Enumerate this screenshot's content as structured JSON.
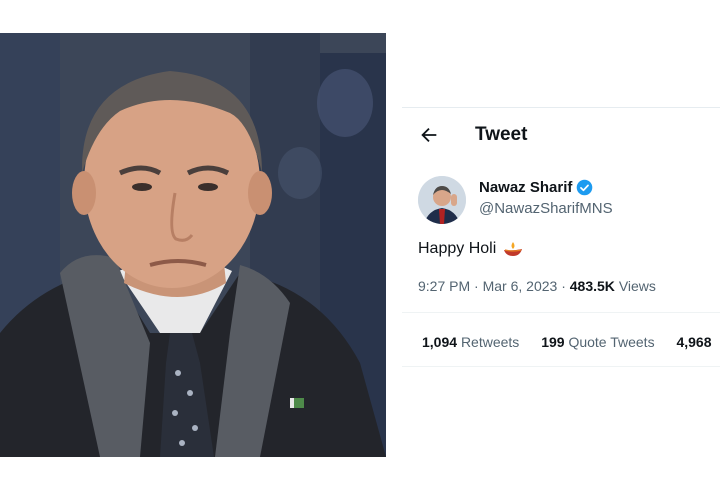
{
  "tweet_header": {
    "title": "Tweet"
  },
  "author": {
    "name": "Nawaz Sharif",
    "handle": "@NawazSharifMNS",
    "verified": true
  },
  "tweet": {
    "text": "Happy Holi",
    "emoji": "diya-lamp-icon",
    "time": "9:27 PM",
    "separator": "·",
    "date": "Mar 6, 2023",
    "views_count": "483.5K",
    "views_label": "Views"
  },
  "stats": [
    {
      "count": "1,094",
      "label": "Retweets"
    },
    {
      "count": "199",
      "label": "Quote Tweets"
    },
    {
      "count": "4,968",
      "label": ""
    }
  ],
  "colors": {
    "verified_blue": "#1d9bf0",
    "secondary_text": "#536471",
    "primary_text": "#0f1419"
  }
}
